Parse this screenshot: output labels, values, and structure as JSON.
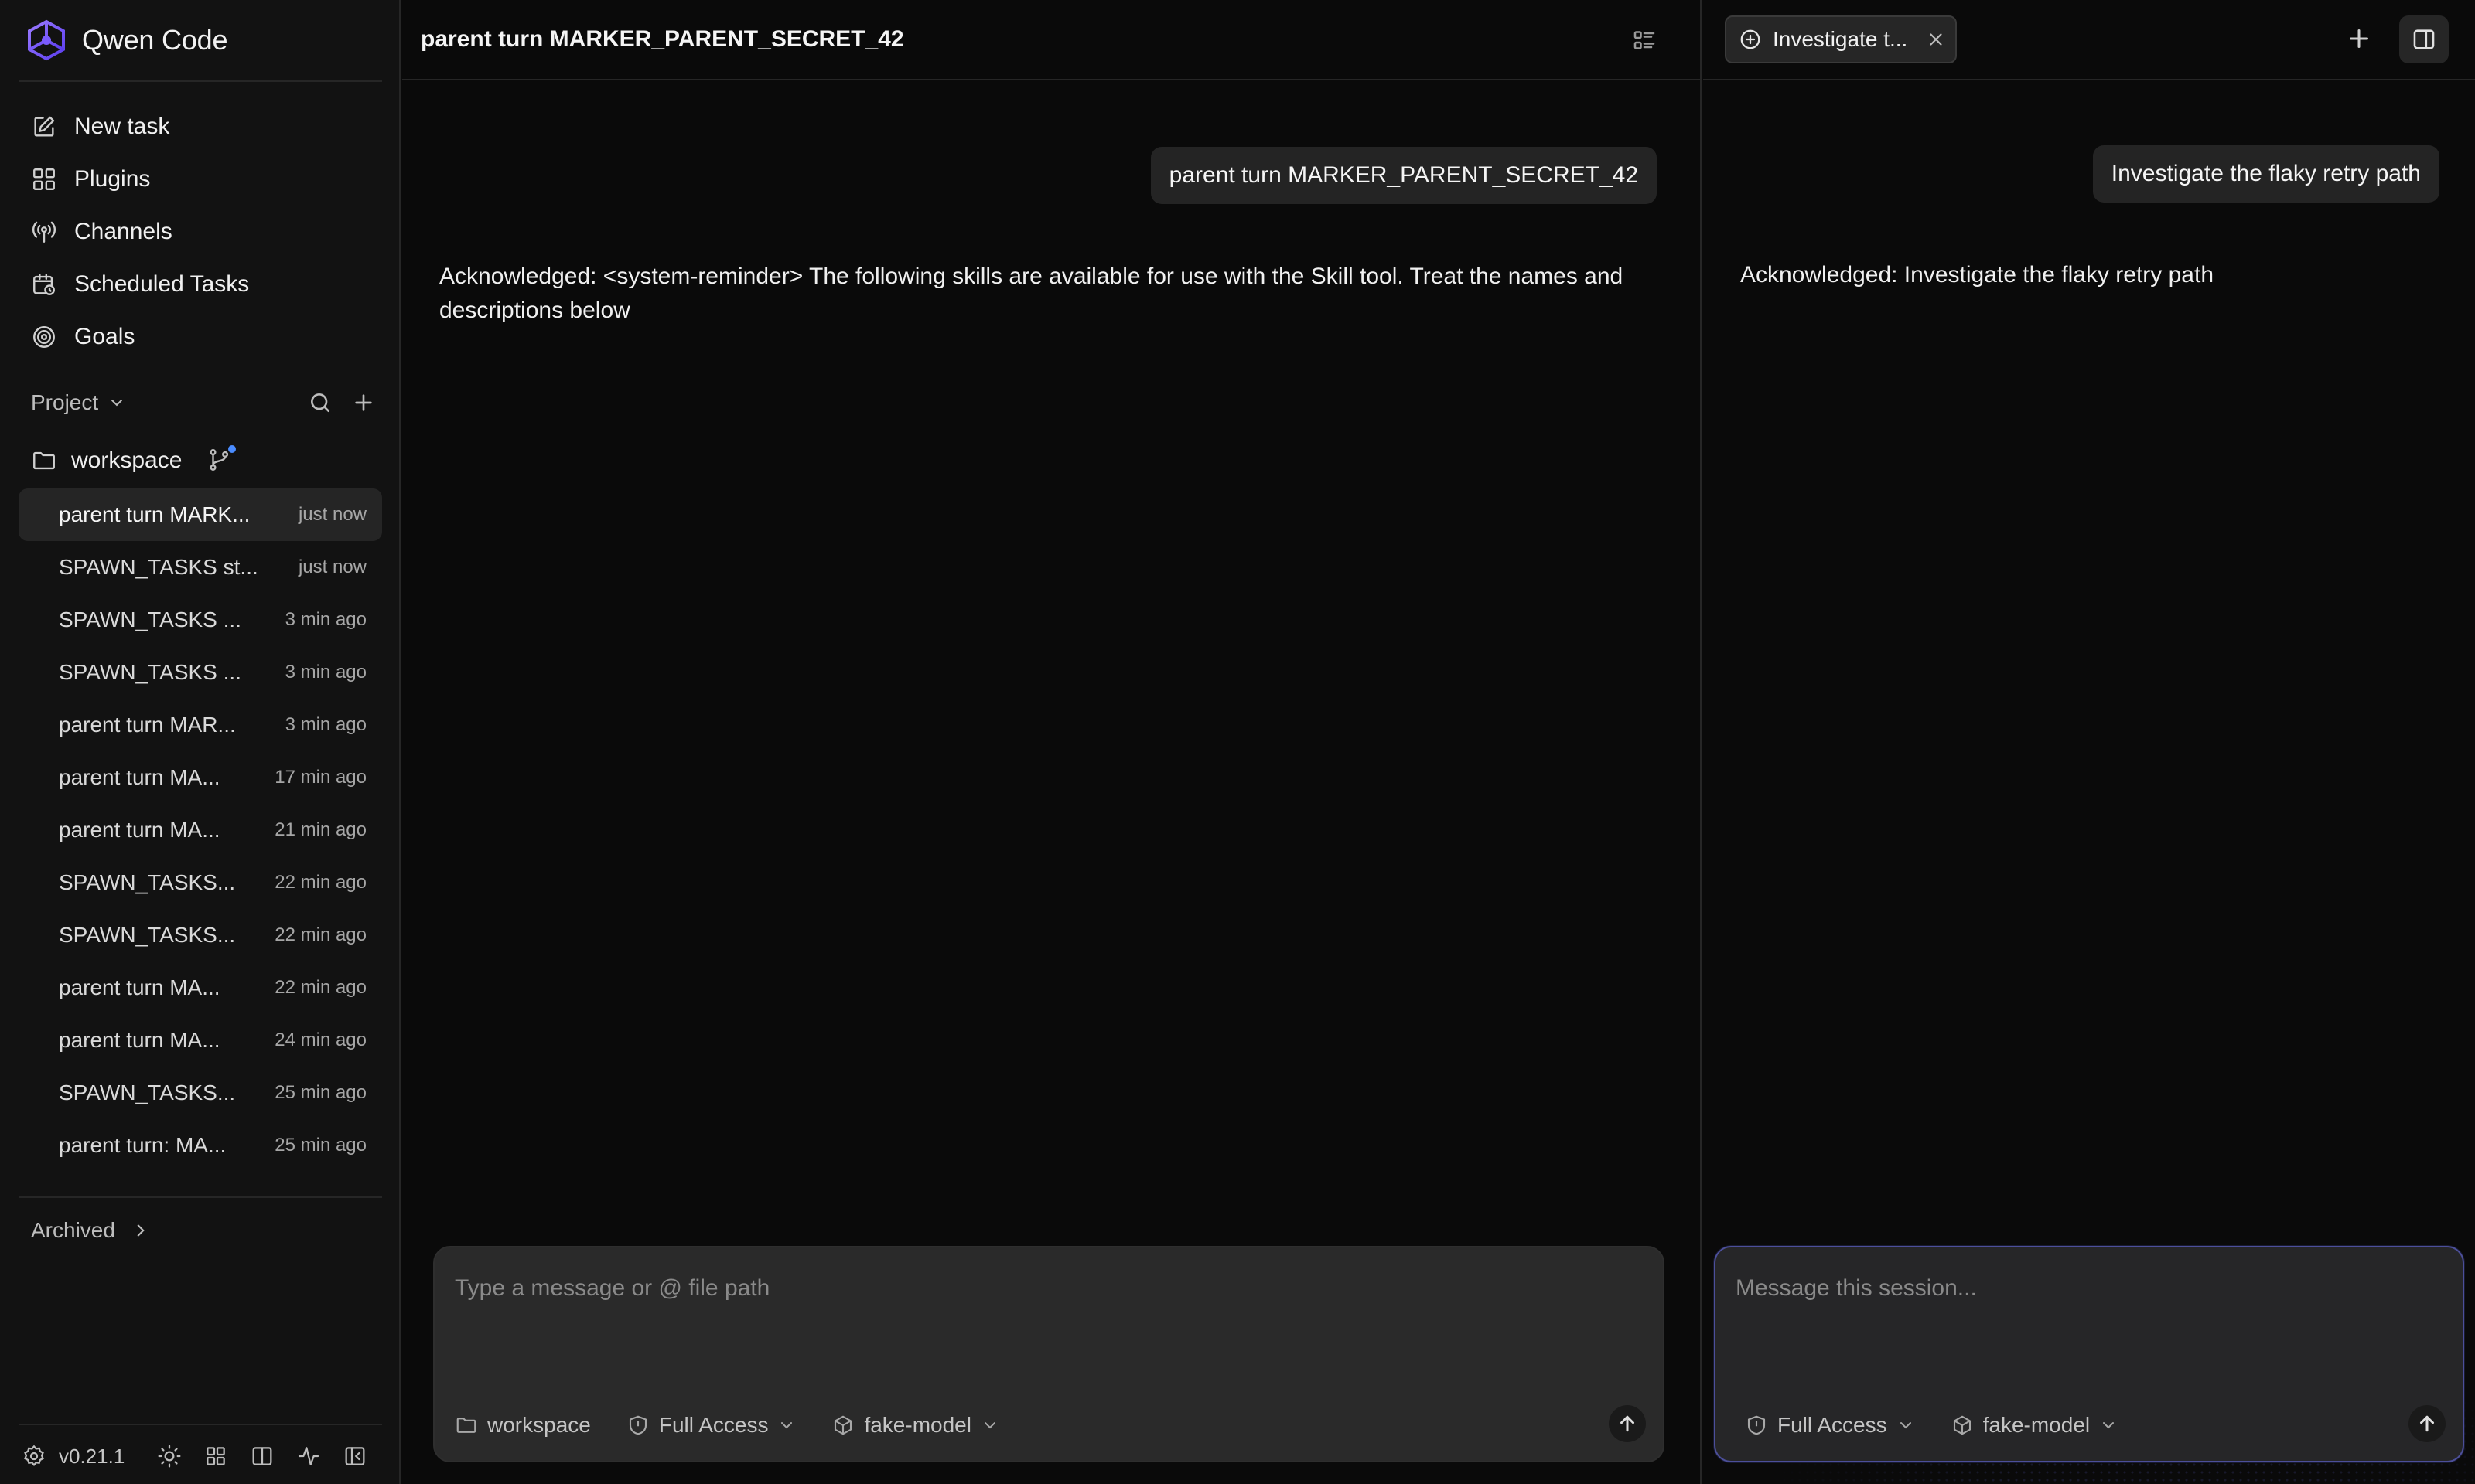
{
  "app": {
    "name": "Qwen Code",
    "version": "v0.21.1"
  },
  "sidebar": {
    "nav": [
      {
        "label": "New task",
        "icon": "edit-icon"
      },
      {
        "label": "Plugins",
        "icon": "plugins-icon"
      },
      {
        "label": "Channels",
        "icon": "broadcast-icon"
      },
      {
        "label": "Scheduled Tasks",
        "icon": "calendar-clock-icon"
      },
      {
        "label": "Goals",
        "icon": "target-icon"
      }
    ],
    "project_label": "Project",
    "workspace": "workspace",
    "sessions": [
      {
        "title": "parent turn MARK...",
        "time": "just now",
        "active": true
      },
      {
        "title": "SPAWN_TASKS st...",
        "time": "just now"
      },
      {
        "title": "SPAWN_TASKS ...",
        "time": "3 min ago"
      },
      {
        "title": "SPAWN_TASKS ...",
        "time": "3 min ago"
      },
      {
        "title": "parent turn MAR...",
        "time": "3 min ago"
      },
      {
        "title": "parent turn MA...",
        "time": "17 min ago"
      },
      {
        "title": "parent turn MA...",
        "time": "21 min ago"
      },
      {
        "title": "SPAWN_TASKS...",
        "time": "22 min ago"
      },
      {
        "title": "SPAWN_TASKS...",
        "time": "22 min ago"
      },
      {
        "title": "parent turn MA...",
        "time": "22 min ago"
      },
      {
        "title": "parent turn MA...",
        "time": "24 min ago"
      },
      {
        "title": "SPAWN_TASKS...",
        "time": "25 min ago"
      },
      {
        "title": "parent turn: MA...",
        "time": "25 min ago"
      }
    ],
    "archived_label": "Archived"
  },
  "main": {
    "title": "parent turn MARKER_PARENT_SECRET_42",
    "user_message": "parent turn MARKER_PARENT_SECRET_42",
    "assistant_line1": "Acknowledged: <system-reminder> The following skills are available for use with the Skill tool. Treat the names and",
    "assistant_line2": "descriptions below",
    "composer": {
      "placeholder": "Type a message or @ file path",
      "workspace": "workspace",
      "access": "Full Access",
      "model": "fake-model"
    }
  },
  "side_session": {
    "tab_label": "Investigate t...",
    "user_message": "Investigate the flaky retry path",
    "assistant_text": "Acknowledged: Investigate the flaky retry path",
    "composer": {
      "placeholder": "Message this session...",
      "access": "Full Access",
      "model": "fake-model"
    }
  },
  "colors": {
    "background": "#0a0a0a",
    "sidebar": "#121212",
    "bubble": "#242424",
    "composer": "#2a2a2a",
    "brand_accent": "#7b5cff",
    "branch_dot": "#4a8cff"
  }
}
